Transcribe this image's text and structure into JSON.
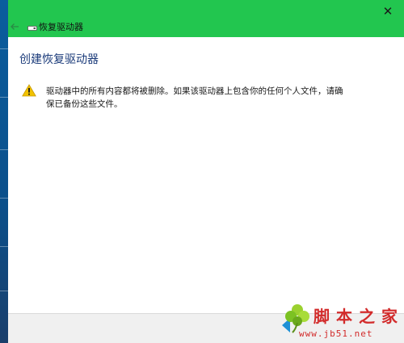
{
  "window": {
    "title": "恢复驱动器",
    "close_glyph": "✕"
  },
  "main": {
    "heading": "创建恢复驱动器",
    "warning_text": "驱动器中的所有内容都将被删除。如果该驱动器上包含你的任何个人文件，请确保已备份这些文件。"
  },
  "watermark": {
    "title": "脚本之家",
    "url": "www.jb51.net"
  },
  "icons": {
    "back": "back-arrow-icon",
    "drive": "drive-icon",
    "warning": "warning-icon",
    "close": "close-icon",
    "clover": "clover-icon"
  },
  "colors": {
    "titlebar": "#22c64f",
    "heading": "#1b3b7a",
    "warning_yellow": "#f2c200",
    "watermark": "#d22b2b",
    "footer": "#f0f0f0"
  }
}
